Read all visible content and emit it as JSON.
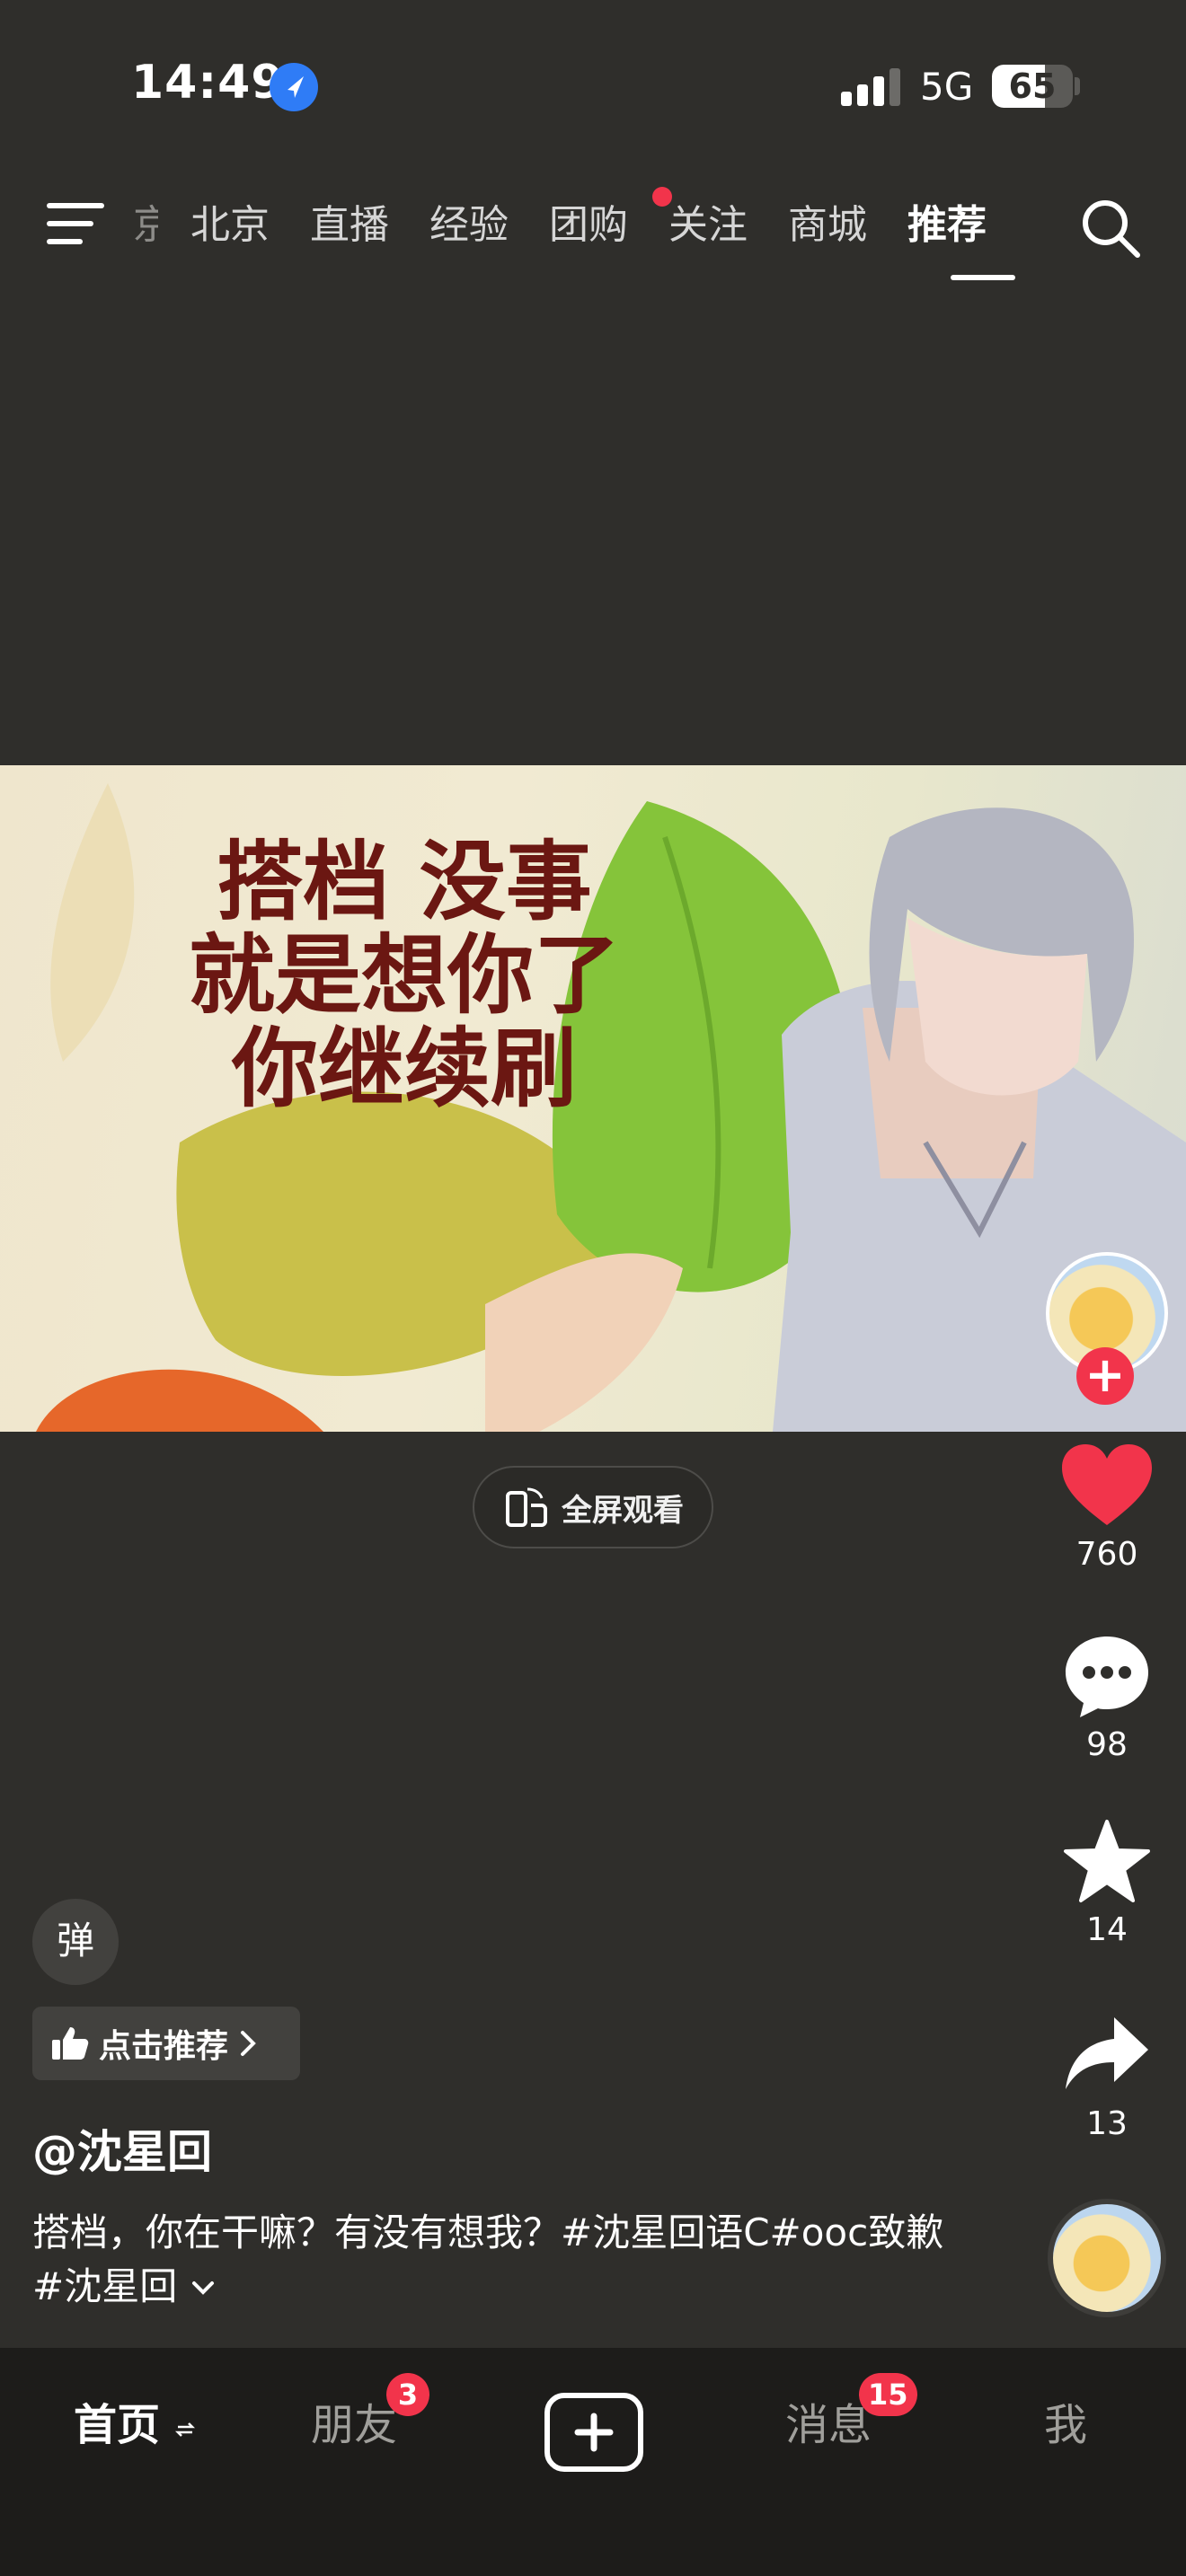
{
  "status_bar": {
    "time": "14:49",
    "network": "5G",
    "battery": "65",
    "battery_level": 0.65
  },
  "top_nav": {
    "tabs": [
      {
        "label": "京"
      },
      {
        "label": "北京"
      },
      {
        "label": "直播"
      },
      {
        "label": "经验"
      },
      {
        "label": "团购",
        "has_dot": true
      },
      {
        "label": "关注"
      },
      {
        "label": "商城"
      },
      {
        "label": "推荐",
        "active": true
      }
    ],
    "icons": [
      "menu-icon",
      "search-icon"
    ]
  },
  "video": {
    "caption_lines": [
      "搭档 没事",
      "就是想你了",
      "你继续刷"
    ],
    "fullscreen_label": "全屏观看"
  },
  "actions": {
    "like_count": "760",
    "comment_count": "98",
    "favorite_count": "14",
    "share_count": "13"
  },
  "bottom_left": {
    "danmu_label": "弹",
    "recommend_label": "点击推荐",
    "author": "@沈星回",
    "description": "搭档，你在干嘛？有没有想我？#沈星回语C#ooc致歉#沈星回"
  },
  "bottom_nav": {
    "home_label": "首页",
    "friends_label": "朋友",
    "friends_badge": "3",
    "messages_label": "消息",
    "messages_badge": "15",
    "me_label": "我"
  },
  "colors": {
    "background": "#2f2e2b",
    "accent_red": "#f2344b",
    "location_blue": "#2f7cf6",
    "caption_red": "#6b1712"
  }
}
